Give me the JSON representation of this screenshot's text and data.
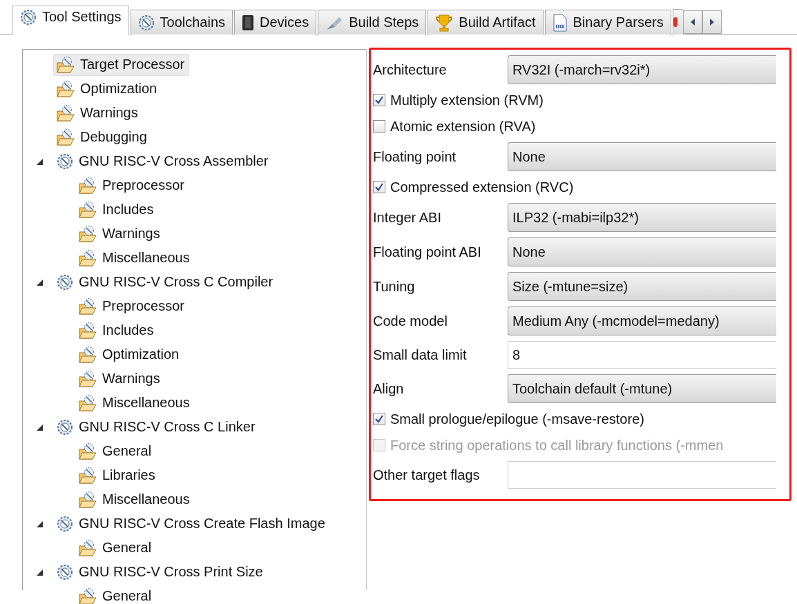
{
  "tabs": [
    {
      "label": "Tool Settings",
      "kind": "gear",
      "selected": true
    },
    {
      "label": "Toolchains",
      "kind": "gear",
      "selected": false
    },
    {
      "label": "Devices",
      "kind": "chip",
      "selected": false
    },
    {
      "label": "Build Steps",
      "kind": "pen",
      "selected": false
    },
    {
      "label": "Build Artifact",
      "kind": "trophy",
      "selected": false
    },
    {
      "label": "Binary Parsers",
      "kind": "binary",
      "selected": false
    }
  ],
  "tree": [
    {
      "label": "Target Processor",
      "selected": true
    },
    {
      "label": "Optimization",
      "selected": false
    },
    {
      "label": "Warnings",
      "selected": false
    },
    {
      "label": "Debugging",
      "selected": false
    },
    {
      "label": "GNU RISC-V Cross Assembler",
      "selected": false,
      "expanded": true,
      "children": [
        {
          "label": "Preprocessor",
          "selected": false
        },
        {
          "label": "Includes",
          "selected": false
        },
        {
          "label": "Warnings",
          "selected": false
        },
        {
          "label": "Miscellaneous",
          "selected": false
        }
      ]
    },
    {
      "label": "GNU RISC-V Cross C Compiler",
      "selected": false,
      "expanded": true,
      "children": [
        {
          "label": "Preprocessor",
          "selected": false
        },
        {
          "label": "Includes",
          "selected": false
        },
        {
          "label": "Optimization",
          "selected": false
        },
        {
          "label": "Warnings",
          "selected": false
        },
        {
          "label": "Miscellaneous",
          "selected": false
        }
      ]
    },
    {
      "label": "GNU RISC-V Cross C Linker",
      "selected": false,
      "expanded": true,
      "children": [
        {
          "label": "General",
          "selected": false
        },
        {
          "label": "Libraries",
          "selected": false
        },
        {
          "label": "Miscellaneous",
          "selected": false
        }
      ]
    },
    {
      "label": "GNU RISC-V Cross Create Flash Image",
      "selected": false,
      "expanded": true,
      "children": [
        {
          "label": "General",
          "selected": false
        }
      ]
    },
    {
      "label": "GNU RISC-V Cross Print Size",
      "selected": false,
      "expanded": true,
      "children": [
        {
          "label": "General",
          "selected": false
        }
      ]
    }
  ],
  "settings": [
    {
      "kind": "combo",
      "label": "Architecture",
      "value": "RV32I (-march=rv32i*)"
    },
    {
      "kind": "checkbox",
      "label": "Multiply extension (RVM)",
      "checked": true,
      "disabled": false
    },
    {
      "kind": "checkbox",
      "label": "Atomic extension (RVA)",
      "checked": false,
      "disabled": false
    },
    {
      "kind": "combo",
      "label": "Floating point",
      "value": "None"
    },
    {
      "kind": "checkbox",
      "label": "Compressed extension (RVC)",
      "checked": true,
      "disabled": false
    },
    {
      "kind": "combo",
      "label": "Integer ABI",
      "value": "ILP32 (-mabi=ilp32*)"
    },
    {
      "kind": "combo",
      "label": "Floating point ABI",
      "value": "None"
    },
    {
      "kind": "combo",
      "label": "Tuning",
      "value": "Size (-mtune=size)"
    },
    {
      "kind": "combo",
      "label": "Code model",
      "value": "Medium Any (-mcmodel=medany)"
    },
    {
      "kind": "text",
      "label": "Small data limit",
      "value": "8"
    },
    {
      "kind": "combo",
      "label": "Align",
      "value": "Toolchain default (-mtune)"
    },
    {
      "kind": "checkbox",
      "label": "Small prologue/epilogue (-msave-restore)",
      "checked": true,
      "disabled": false
    },
    {
      "kind": "checkbox",
      "label": "Force string operations to call library functions (-mmen",
      "checked": false,
      "disabled": true
    },
    {
      "kind": "text",
      "label": "Other target flags"
    }
  ]
}
